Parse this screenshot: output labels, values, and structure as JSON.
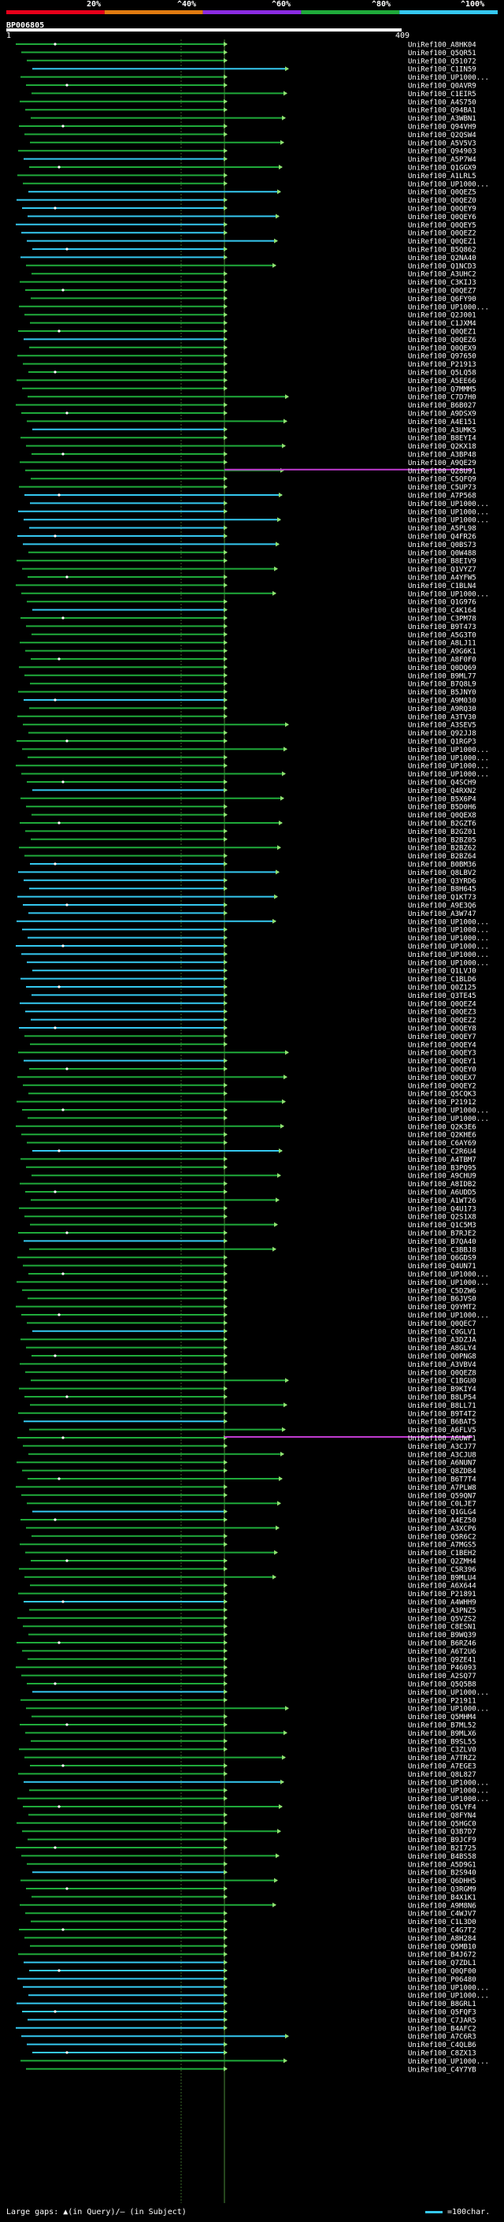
{
  "header": {
    "query_id": "BP006805",
    "pct_labels": [
      "20%",
      "^40%",
      "^60%",
      "^80%",
      "^100%"
    ],
    "colors": [
      "#e8001a",
      "#e07a10",
      "#8a2be2",
      "#1faa3a",
      "#35c8f0"
    ],
    "ruler_start": "1",
    "ruler_end": "409"
  },
  "footer": {
    "legend_text": "Large gaps: ▲(in Query)/‒ (in Subject)",
    "scale_text": "=100char."
  },
  "chart_data": {
    "type": "alignment",
    "query_length": 409,
    "hits": [
      "UniRef100_A8HK04",
      "UniRef100_Q5QR51",
      "UniRef100_Q51072",
      "UniRef100_C1IN59",
      "UniRef100_UP1000...",
      "UniRef100_Q0AVR9",
      "UniRef100_C1EIR5",
      "UniRef100_A4S750",
      "UniRef100_Q94BA1",
      "UniRef100_A3WBN1",
      "UniRef100_Q94VH9",
      "UniRef100_Q2QSW4",
      "UniRef100_A5V5V3",
      "UniRef100_Q94903",
      "UniRef100_A5P7W4",
      "UniRef100_Q1GGX9",
      "UniRef100_A1LRL5",
      "UniRef100_UP1000...",
      "UniRef100_Q0QEZ5",
      "UniRef100_Q0QEZ0",
      "UniRef100_Q0QEY9",
      "UniRef100_Q0QEY6",
      "UniRef100_Q0QEY5",
      "UniRef100_Q0QEZ2",
      "UniRef100_Q0QEZ1",
      "UniRef100_B5Q862",
      "UniRef100_Q2NA40",
      "UniRef100_Q1NCD3",
      "UniRef100_A3UHC2",
      "UniRef100_C3KIJ3",
      "UniRef100_Q0QEZ7",
      "UniRef100_Q6FY90",
      "UniRef100_UP1000...",
      "UniRef100_Q2J001",
      "UniRef100_C1JXM4",
      "UniRef100_Q0QEZ1",
      "UniRef100_Q0QEZ6",
      "UniRef100_Q0QEX9",
      "UniRef100_Q97650",
      "UniRef100_P21913",
      "UniRef100_Q5LQ58",
      "UniRef100_A5EE66",
      "UniRef100_Q7MMM5",
      "UniRef100_C7D7H0",
      "UniRef100_B6B027",
      "UniRef100_A9DSX9",
      "UniRef100_A4E151",
      "UniRef100_A3UMK5",
      "UniRef100_B8EYI4",
      "UniRef100_Q2KX18",
      "UniRef100_A3BP48",
      "UniRef100_A9QE29",
      "UniRef100_Q28U91",
      "UniRef100_C5QFQ9",
      "UniRef100_C5UP73",
      "UniRef100_A7P568",
      "UniRef100_UP1000...",
      "UniRef100_UP1000...",
      "UniRef100_UP1000...",
      "UniRef100_A5PL98",
      "UniRef100_Q4FR26",
      "UniRef100_Q0BS73",
      "UniRef100_Q0W488",
      "UniRef100_B8EIV9",
      "UniRef100_Q1VYZ7",
      "UniRef100_A4YFW5",
      "UniRef100_C1BLN4",
      "UniRef100_UP1000...",
      "UniRef100_Q1G976",
      "UniRef100_C4K164",
      "UniRef100_C3PM78",
      "UniRef100_B9T473",
      "UniRef100_A5G3T0",
      "UniRef100_A8LJ11",
      "UniRef100_A9G6K1",
      "UniRef100_A8F0F0",
      "UniRef100_Q0DQ69",
      "UniRef100_B9ML77",
      "UniRef100_B7Q8L9",
      "UniRef100_B5JNY0",
      "UniRef100_A9M030",
      "UniRef100_A9RQ30",
      "UniRef100_A3TV30",
      "UniRef100_A3SEV5",
      "UniRef100_Q92JJ8",
      "UniRef100_Q1RGP3",
      "UniRef100_UP1000...",
      "UniRef100_UP1000...",
      "UniRef100_UP1000...",
      "UniRef100_UP1000...",
      "UniRef100_Q4SCH9",
      "UniRef100_Q4RXN2",
      "UniRef100_B5X6P4",
      "UniRef100_B5D0H6",
      "UniRef100_Q0QEX8",
      "UniRef100_B2GZT6",
      "UniRef100_B2GZ01",
      "UniRef100_B2BZ05",
      "UniRef100_B2BZ62",
      "UniRef100_B2BZ64",
      "UniRef100_B0BM36",
      "UniRef100_Q8LBV2",
      "UniRef100_Q3YRD6",
      "UniRef100_B8H645",
      "UniRef100_Q1KT73",
      "UniRef100_A9E3Q6",
      "UniRef100_A3W747",
      "UniRef100_UP1000...",
      "UniRef100_UP1000...",
      "UniRef100_UP1000...",
      "UniRef100_UP1000...",
      "UniRef100_UP1000...",
      "UniRef100_UP1000...",
      "UniRef100_Q1LVJ0",
      "UniRef100_C1BLD6",
      "UniRef100_Q0Z125",
      "UniRef100_Q3TE45",
      "UniRef100_Q0QEZ4",
      "UniRef100_Q0QEZ3",
      "UniRef100_Q0QEZ2",
      "UniRef100_Q0QEY8",
      "UniRef100_Q0QEY7",
      "UniRef100_Q0QEY4",
      "UniRef100_Q0QEY3",
      "UniRef100_Q0QEY1",
      "UniRef100_Q0QEY0",
      "UniRef100_Q0QEX7",
      "UniRef100_Q0QEY2",
      "UniRef100_Q5CQK3",
      "UniRef100_P21912",
      "UniRef100_UP1000...",
      "UniRef100_UP1000...",
      "UniRef100_Q2K3E6",
      "UniRef100_Q2KHE6",
      "UniRef100_C6AY69",
      "UniRef100_C2R6U4",
      "UniRef100_A4TBM7",
      "UniRef100_B3PQ95",
      "UniRef100_A9CHU9",
      "UniRef100_A8IDB2",
      "UniRef100_A6UDD5",
      "UniRef100_A1WT26",
      "UniRef100_Q4U173",
      "UniRef100_Q2S1X8",
      "UniRef100_Q1C5M3",
      "UniRef100_B7RJE2",
      "UniRef100_B7QA40",
      "UniRef100_C3BBJ8",
      "UniRef100_Q6GDS9",
      "UniRef100_Q4UN71",
      "UniRef100_UP1000...",
      "UniRef100_UP1000...",
      "UniRef100_C5DZW6",
      "UniRef100_B6JVS0",
      "UniRef100_Q9YMT2",
      "UniRef100_UP1000...",
      "UniRef100_Q0QEC7",
      "UniRef100_C0GLV1",
      "UniRef100_A3DZJA",
      "UniRef100_A8GLY4",
      "UniRef100_Q0PNG8",
      "UniRef100_A3VBV4",
      "UniRef100_Q0QEZ8",
      "UniRef100_C1BGU0",
      "UniRef100_B9KIY4",
      "UniRef100_B8LP54",
      "UniRef100_B8LL71",
      "UniRef100_B9T4T2",
      "UniRef100_B6BAT5",
      "UniRef100_A6FLV5",
      "UniRef100_A6UWF1",
      "UniRef100_A3CJ77",
      "UniRef100_A3CJU8",
      "UniRef100_A6NUN7",
      "UniRef100_Q8ZDB4",
      "UniRef100_B6T7T4",
      "UniRef100_A7PLW8",
      "UniRef100_Q59QN7",
      "UniRef100_C0LJE7",
      "UniRef100_Q1GLG4",
      "UniRef100_A4EZ50",
      "UniRef100_A3XCP6",
      "UniRef100_Q5R6C2",
      "UniRef100_A7MGS5",
      "UniRef100_C1BEH2",
      "UniRef100_Q2ZMH4",
      "UniRef100_C5R396",
      "UniRef100_B9MLU4",
      "UniRef100_A6X644",
      "UniRef100_P21891",
      "UniRef100_A4WHH9",
      "UniRef100_A3PNZ5",
      "UniRef100_Q5VZS2",
      "UniRef100_C8ESN1",
      "UniRef100_B9WQ39",
      "UniRef100_B6RZ46",
      "UniRef100_A6T2U6",
      "UniRef100_Q9ZE41",
      "UniRef100_P46093",
      "UniRef100_A2SQ77",
      "UniRef100_Q5Q5B8",
      "UniRef100_UP1000...",
      "UniRef100_P21911",
      "UniRef100_UP1000...",
      "UniRef100_Q5MHM4",
      "UniRef100_B7ML52",
      "UniRef100_B9MLX6",
      "UniRef100_B9SL55",
      "UniRef100_C3ZLV0",
      "UniRef100_A7TRZ2",
      "UniRef100_A7EGE3",
      "UniRef100_Q8L827",
      "UniRef100_UP1000...",
      "UniRef100_UP1000...",
      "UniRef100_UP1000...",
      "UniRef100_Q5LYF4",
      "UniRef100_Q8FYN4",
      "UniRef100_Q5HGC0",
      "UniRef100_Q3B7D7",
      "UniRef100_B9JCF9",
      "UniRef100_B2I725",
      "UniRef100_B4BS58",
      "UniRef100_A5D9G1",
      "UniRef100_B2S940",
      "UniRef100_Q6DHH5",
      "UniRef100_Q3RGM9",
      "UniRef100_B4X1K1",
      "UniRef100_A9M8N6",
      "UniRef100_C4WJV7",
      "UniRef100_C1L3D0",
      "UniRef100_C4G7T2",
      "UniRef100_A8H284",
      "UniRef100_Q5MB10",
      "UniRef100_B4J672",
      "UniRef100_Q7ZDL1",
      "UniRef100_Q0QF00",
      "UniRef100_P06480",
      "UniRef100_UP1000...",
      "UniRef100_UP1000...",
      "UniRef100_B8GRL1",
      "UniRef100_Q5FQF3",
      "UniRef100_C7JAR5",
      "UniRef100_B4AFC2",
      "UniRef100_A7C6R3",
      "UniRef100_C4QLB6",
      "UniRef100_C8ZX13",
      "UniRef100_UP1000...",
      "UniRef100_C4Y7YB"
    ]
  }
}
